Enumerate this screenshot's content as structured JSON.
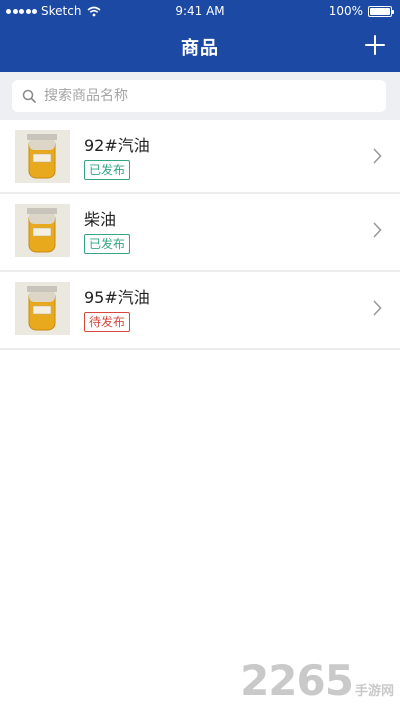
{
  "status_bar": {
    "carrier": "Sketch",
    "time": "9:41 AM",
    "battery": "100%"
  },
  "header": {
    "title": "商品",
    "add_icon": "plus-icon"
  },
  "search": {
    "placeholder": "搜索商品名称",
    "icon": "search-icon"
  },
  "products": [
    {
      "name": "92#汽油",
      "status": "已发布",
      "status_type": "published"
    },
    {
      "name": "柴油",
      "status": "已发布",
      "status_type": "published"
    },
    {
      "name": "95#汽油",
      "status": "待发布",
      "status_type": "pending"
    }
  ],
  "colors": {
    "header_bg": "#1b49a3",
    "published": "#35a583",
    "pending": "#d5473c"
  },
  "watermark": {
    "number": "2265",
    "label": "手游网"
  }
}
